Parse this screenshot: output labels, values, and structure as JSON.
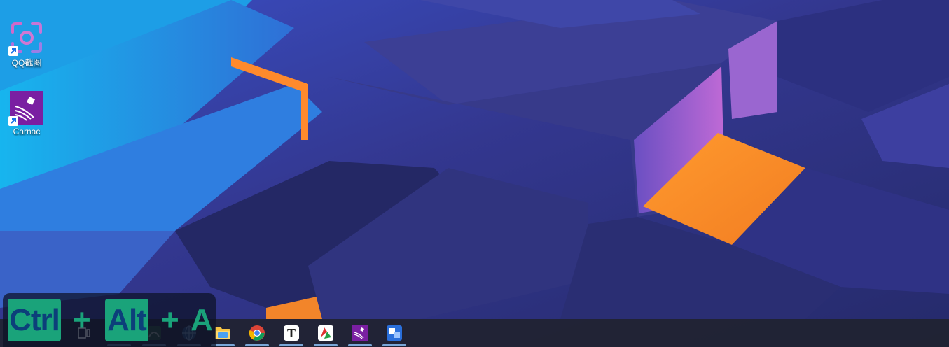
{
  "desktop": {
    "icons": [
      {
        "label": "QQ截图",
        "icon": "qq-screenshot-icon"
      },
      {
        "label": "Carnac",
        "icon": "carnac-icon"
      }
    ]
  },
  "keystroke_overlay": {
    "keys": [
      "Ctrl",
      "Alt",
      "A"
    ],
    "separator": "+",
    "accent_color": "#1aa37a"
  },
  "taskbar": {
    "items": [
      {
        "name": "start",
        "icon": "windows-start-icon"
      },
      {
        "name": "search",
        "icon": "search-icon"
      },
      {
        "name": "task-view",
        "icon": "task-view-icon"
      },
      {
        "name": "widgets",
        "icon": "widgets-icon"
      },
      {
        "name": "app",
        "icon": "app-icon"
      },
      {
        "name": "globe",
        "icon": "globe-icon"
      },
      {
        "name": "file-explorer",
        "icon": "folder-icon"
      },
      {
        "name": "chrome",
        "icon": "chrome-icon"
      },
      {
        "name": "typora",
        "icon": "typora-icon",
        "label": "T"
      },
      {
        "name": "app-red-green",
        "icon": "red-green-app-icon"
      },
      {
        "name": "carnac",
        "icon": "carnac-icon"
      },
      {
        "name": "translator",
        "icon": "translate-icon"
      }
    ]
  }
}
